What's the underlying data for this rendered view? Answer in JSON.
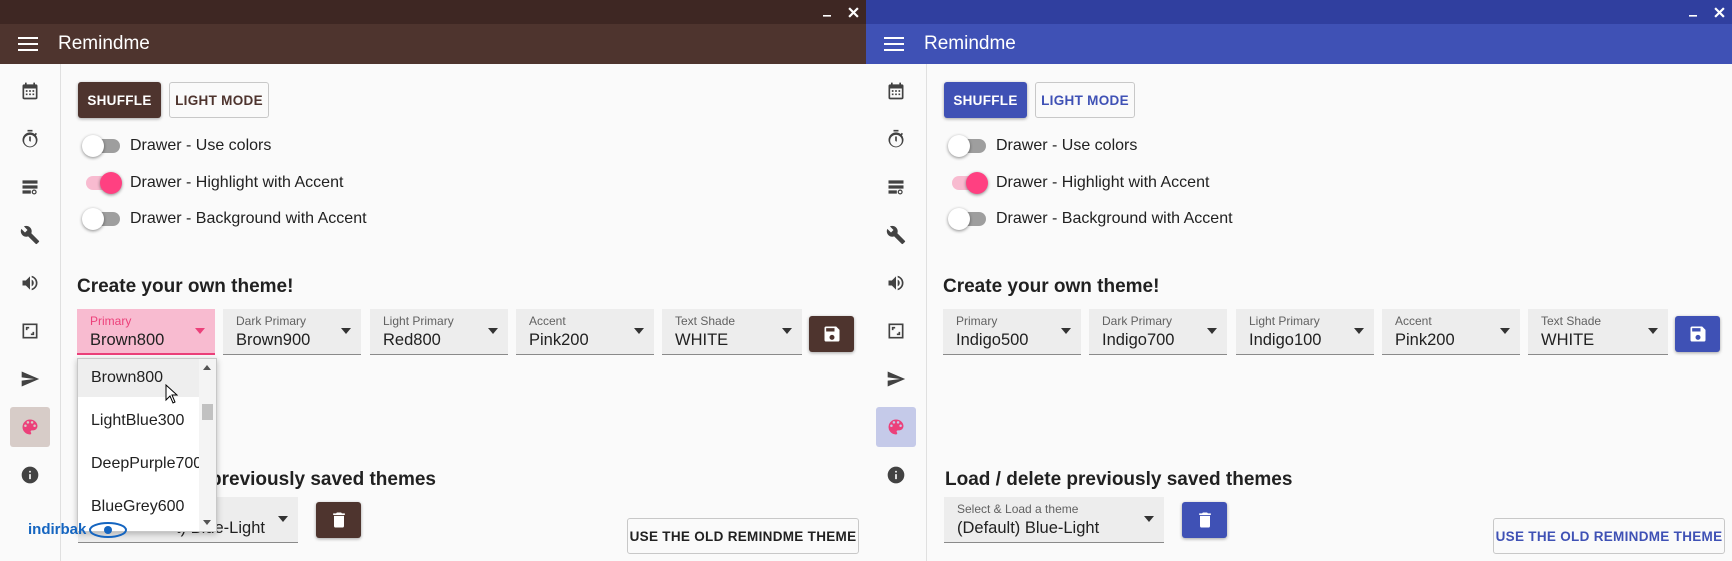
{
  "app_title": "Remindme",
  "buttons": {
    "shuffle": "SHUFFLE",
    "light_mode": "LIGHT MODE",
    "old_theme": "USE THE OLD REMINDME THEME"
  },
  "toggles": [
    {
      "label": "Drawer - Use colors",
      "on": false
    },
    {
      "label": "Drawer - Highlight with Accent",
      "on": true
    },
    {
      "label": "Drawer - Background with Accent",
      "on": false
    }
  ],
  "create_title": "Create your own theme!",
  "load_title": "Load / delete previously saved themes",
  "load_title_left_visible": "previously saved themes",
  "load_select_label": "Select & Load a theme",
  "load_select_value": "(Default) Blue-Light",
  "load_select_value_left_visible": "t) Blue-Light",
  "field_labels": {
    "primary": "Primary",
    "dark_primary": "Dark Primary",
    "light_primary": "Light Primary",
    "accent": "Accent",
    "text_shade": "Text Shade"
  },
  "left": {
    "colors": {
      "titlebar": "#3e2723",
      "appbar": "#4e342e",
      "primary": "#4e342e",
      "accent": "#ff4081"
    },
    "primary": "Brown800",
    "dark_primary": "Brown900",
    "light_primary": "Red800",
    "accent": "Pink200",
    "text_shade": "WHITE",
    "dropdown_items": [
      "Brown800",
      "LightBlue300",
      "DeepPurple700",
      "BlueGrey600"
    ]
  },
  "right": {
    "colors": {
      "titlebar": "#303f9f",
      "appbar": "#3f51b5",
      "primary": "#3f51b5",
      "accent": "#ff4081"
    },
    "primary": "Indigo500",
    "dark_primary": "Indigo700",
    "light_primary": "Indigo100",
    "accent": "Pink200",
    "text_shade": "WHITE"
  },
  "rail_icons": [
    "calendar-icon",
    "timer-icon",
    "storage-icon",
    "wrench-icon",
    "volume-icon",
    "crop-icon",
    "send-icon",
    "palette-icon",
    "info-icon"
  ],
  "watermark": "indirbak"
}
